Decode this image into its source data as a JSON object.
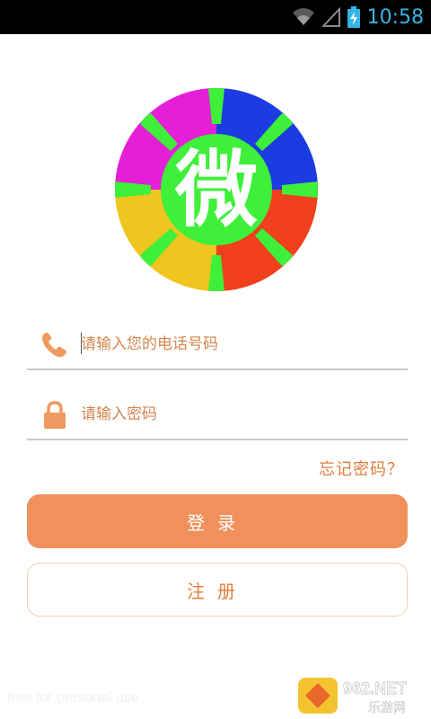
{
  "status_bar": {
    "time": "10:58",
    "icons": [
      "wifi-icon",
      "signal-icon",
      "battery-charging-icon"
    ]
  },
  "logo": {
    "character": "微",
    "colors": [
      "#e41fd6",
      "#1c3be0",
      "#f0401c",
      "#f0c520",
      "#3ef03a"
    ]
  },
  "login_form": {
    "phone_placeholder": "请输入您的电话号码",
    "password_placeholder": "请输入密码",
    "forgot_password": "忘记密码？",
    "login_button": "登录",
    "register_button": "注册"
  },
  "watermark": {
    "left_text": "free for personal use",
    "right_text_top": "962.NET",
    "right_text_bottom": "乐游网"
  },
  "colors": {
    "accent": "#f0915c",
    "text_accent": "#e07d3c"
  }
}
